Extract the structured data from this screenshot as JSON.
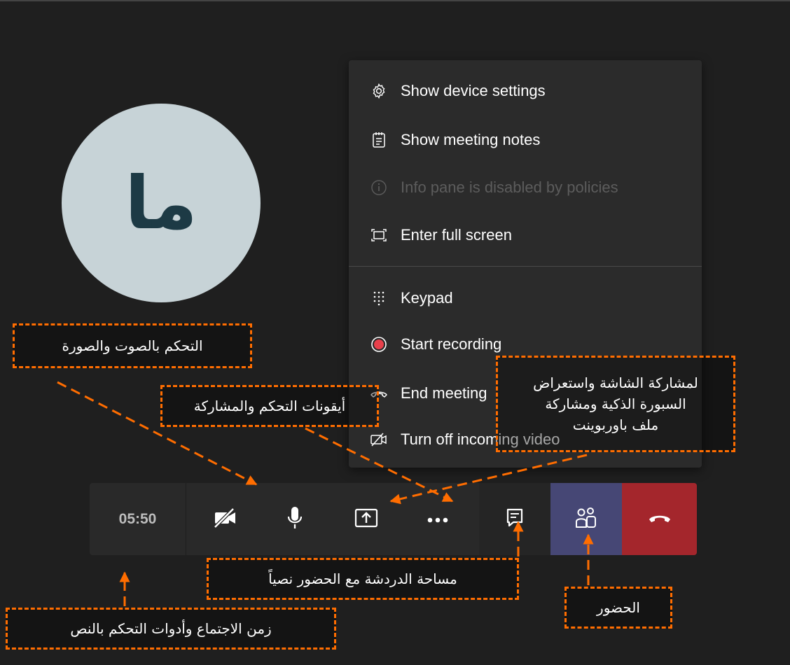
{
  "avatar": {
    "initials": "ما"
  },
  "menu": {
    "items": [
      {
        "label": "Show device settings",
        "icon": "gear-icon",
        "disabled": false
      },
      {
        "label": "Show meeting notes",
        "icon": "notes-icon",
        "disabled": false
      },
      {
        "label": "Info pane is disabled by policies",
        "icon": "info-icon",
        "disabled": true
      },
      {
        "label": "Enter full screen",
        "icon": "fullscreen-icon",
        "disabled": false
      },
      {
        "label": "Keypad",
        "icon": "keypad-icon",
        "disabled": false
      },
      {
        "label": "Start recording",
        "icon": "record-icon",
        "disabled": false
      },
      {
        "label": "End meeting",
        "icon": "end-meeting-icon",
        "disabled": false
      },
      {
        "label": "Turn off incoming video",
        "icon": "video-off-icon",
        "disabled": false
      }
    ]
  },
  "toolbar": {
    "timer": "05:50",
    "buttons": [
      "camera-off-icon",
      "microphone-icon",
      "share-screen-icon",
      "more-options-icon",
      "chat-icon",
      "participants-icon",
      "hang-up-icon"
    ]
  },
  "annotations": {
    "av_control": "التحكم بالصوت والصورة",
    "controls_share": "أيقونات التحكم والمشاركة",
    "share_screen": [
      "لمشاركة الشاشة واستعراض",
      "السبورة الذكية ومشاركة",
      "ملف باوربوينت"
    ],
    "chat": "مساحة الدردشة مع الحضور نصياً",
    "attendees": "الحضور",
    "meeting_time": "زمن الاجتماع وأدوات التحكم بالنص"
  },
  "colors": {
    "annotation": "#ff6d00",
    "background": "#1f1f1f",
    "hangup": "#a4262c",
    "participants": "#464775",
    "record": "#e8404b"
  }
}
